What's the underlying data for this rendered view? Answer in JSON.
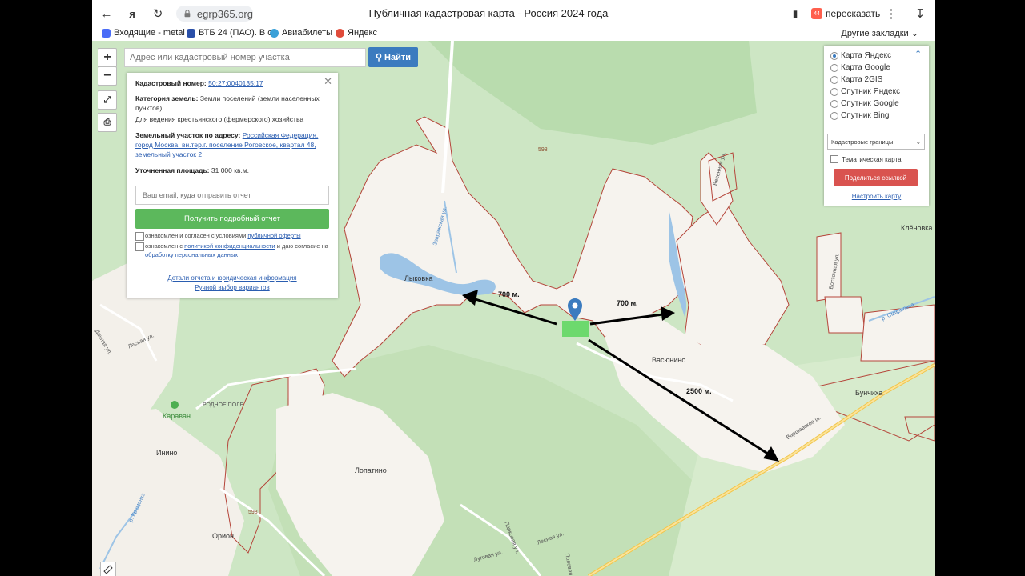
{
  "browser": {
    "url": "egrp365.org",
    "title": "Публичная кадастровая карта - Россия 2024 года",
    "retell_label": "пересказать",
    "retell_badge": "44",
    "bookmarks": [
      {
        "label": "Входящие - metal",
        "color": "#4a6cf7"
      },
      {
        "label": "ВТБ 24 (ПАО). В с",
        "color": "#2a4fa8"
      },
      {
        "label": "Авиабилеты",
        "color": "#3aa0d8"
      },
      {
        "label": "Яндекс",
        "color": "#e04b3a"
      }
    ],
    "other_bookmarks": "Другие закладки"
  },
  "search": {
    "placeholder": "Адрес или кадастровый номер участка",
    "button": "Найти"
  },
  "info": {
    "cadastral_label": "Кадастровый номер:",
    "cadastral_value": "50:27:0040135:17",
    "category_label": "Категория земель:",
    "category_value": "Земли поселений (земли населенных пунктов)",
    "usage": "Для ведения крестьянского (фермерского) хозяйства",
    "address_label": "Земельный участок по адресу:",
    "address_value": "Российская Федерация, город Москва, вн.тер.г. поселение Роговское, квартал 48, земельный участок 2",
    "area_label": "Уточненная площадь:",
    "area_value": "31 000 кв.м.",
    "email_placeholder": "Ваш email, куда отправить отчет",
    "report_button": "Получить подробный отчет",
    "consent1_prefix": "ознакомлен и согласен с условиями",
    "consent1_link": "публичной оферты",
    "consent2_prefix": "ознакомлен с",
    "consent2_link1": "политикой конфиденциальности",
    "consent2_mid": "и даю согласие на",
    "consent2_link2": "обработку персональных данных",
    "details_link": "Детали отчета и юридическая информация",
    "manual_link": "Ручной выбор вариантов"
  },
  "layers": {
    "options": [
      {
        "label": "Карта Яндекс",
        "selected": true
      },
      {
        "label": "Карта Google",
        "selected": false
      },
      {
        "label": "Карта 2GIS",
        "selected": false
      },
      {
        "label": "Спутник Яндекс",
        "selected": false
      },
      {
        "label": "Спутник Google",
        "selected": false
      },
      {
        "label": "Спутник Bing",
        "selected": false
      }
    ],
    "borders_select": "Кадастровые границы",
    "thematic": "Тематическая карта",
    "share_button": "Поделиться ссылкой",
    "setup_link": "Настроить карту"
  },
  "map": {
    "places": {
      "lykovka": "Лыковка",
      "vasyunino": "Васюнино",
      "bunchikha": "Бунчиха",
      "lopatino": "Лопатино",
      "inino": "Инино",
      "orion": "Орион",
      "karavan": "Караван",
      "klenovka": "Клёновка",
      "rodnoe_pole": "РОДНОЕ ПОЛЕ"
    },
    "roads": {
      "r598a": "598",
      "r598b": "598",
      "varshavskoe": "Варшавское ш.",
      "lesnaya": "Лесная ул.",
      "lesnaya2": "Лесная ул.",
      "dachnaya": "Дачная ул.",
      "vesennyaya": "Весенняя ул.",
      "vostochnaya": "Восточная ул.",
      "lugovaya": "Луговая ул.",
      "polevaya": "Полевая ул.",
      "parkovaya": "Парковая ул.",
      "zavrazhnaya": "Завражская ул.",
      "smirnovka": "р. Смирновка",
      "kremenka": "р. Кременка"
    },
    "distances": {
      "west": "700 м.",
      "east": "700 м.",
      "southeast": "2500 м."
    }
  }
}
